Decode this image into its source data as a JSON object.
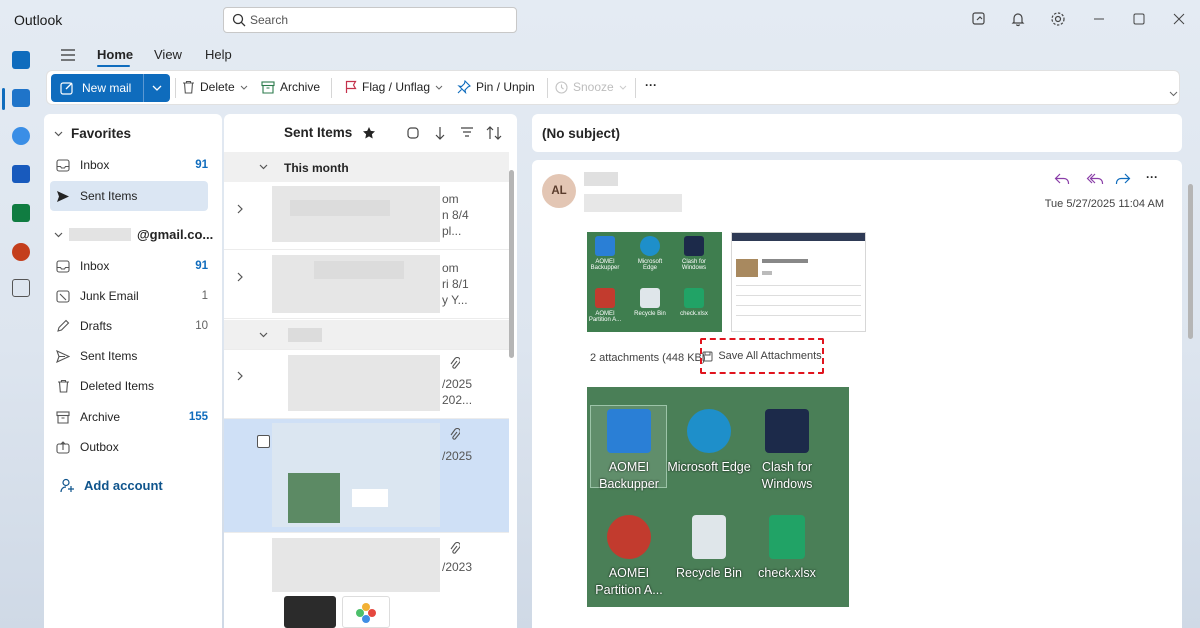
{
  "window": {
    "title": "Outlook"
  },
  "search": {
    "placeholder": "Search"
  },
  "ribbon": {
    "tabs": [
      "Home",
      "View",
      "Help"
    ],
    "new_mail": "New mail",
    "delete": "Delete",
    "archive": "Archive",
    "flag": "Flag / Unflag",
    "pin": "Pin / Unpin",
    "snooze": "Snooze",
    "more": "···"
  },
  "folders": {
    "favorites_label": "Favorites",
    "favorites": [
      {
        "name": "Inbox",
        "count": "91"
      },
      {
        "name": "Sent Items",
        "count": ""
      }
    ],
    "account_label": "@gmail.co...",
    "account_folders": [
      {
        "name": "Inbox",
        "count": "91"
      },
      {
        "name": "Junk Email",
        "count": "1"
      },
      {
        "name": "Drafts",
        "count": "10"
      },
      {
        "name": "Sent Items",
        "count": ""
      },
      {
        "name": "Deleted Items",
        "count": ""
      },
      {
        "name": "Archive",
        "count": "155"
      },
      {
        "name": "Outbox",
        "count": ""
      }
    ],
    "add_account": "Add account"
  },
  "message_list": {
    "title": "Sent Items",
    "group": "This month",
    "row_fragments": [
      {
        "a": "om",
        "b": "n 8/4",
        "c": "pl..."
      },
      {
        "a": "om",
        "b": "ri 8/1",
        "c": "y Y..."
      },
      {
        "a": "/2025",
        "b": "202..."
      },
      {
        "a": "/2025"
      },
      {
        "a": "/2023"
      }
    ]
  },
  "reading": {
    "subject": "(No subject)",
    "avatar_initials": "AL",
    "date": "Tue 5/27/2025 11:04 AM",
    "more": "···",
    "attachments_info": "2 attachments (448 KB)",
    "save_all": "Save All Attachments",
    "thumb_icons": [
      "AOMEI Backupper",
      "Microsoft Edge",
      "Clash for Windows",
      "AOMEI Partition A...",
      "Recycle Bin",
      "check.xlsx"
    ],
    "desktop_icons": [
      {
        "label": "AOMEI Backupper",
        "color": "#2a7fd6"
      },
      {
        "label": "Microsoft Edge",
        "color": "#1e8fca"
      },
      {
        "label": "Clash for Windows",
        "color": "#1c2a4a"
      },
      {
        "label": "AOMEI Partition A...",
        "color": "#c23b2e"
      },
      {
        "label": "Recycle Bin",
        "color": "#dfe6ea"
      },
      {
        "label": "check.xlsx",
        "color": "#21a366"
      }
    ]
  }
}
